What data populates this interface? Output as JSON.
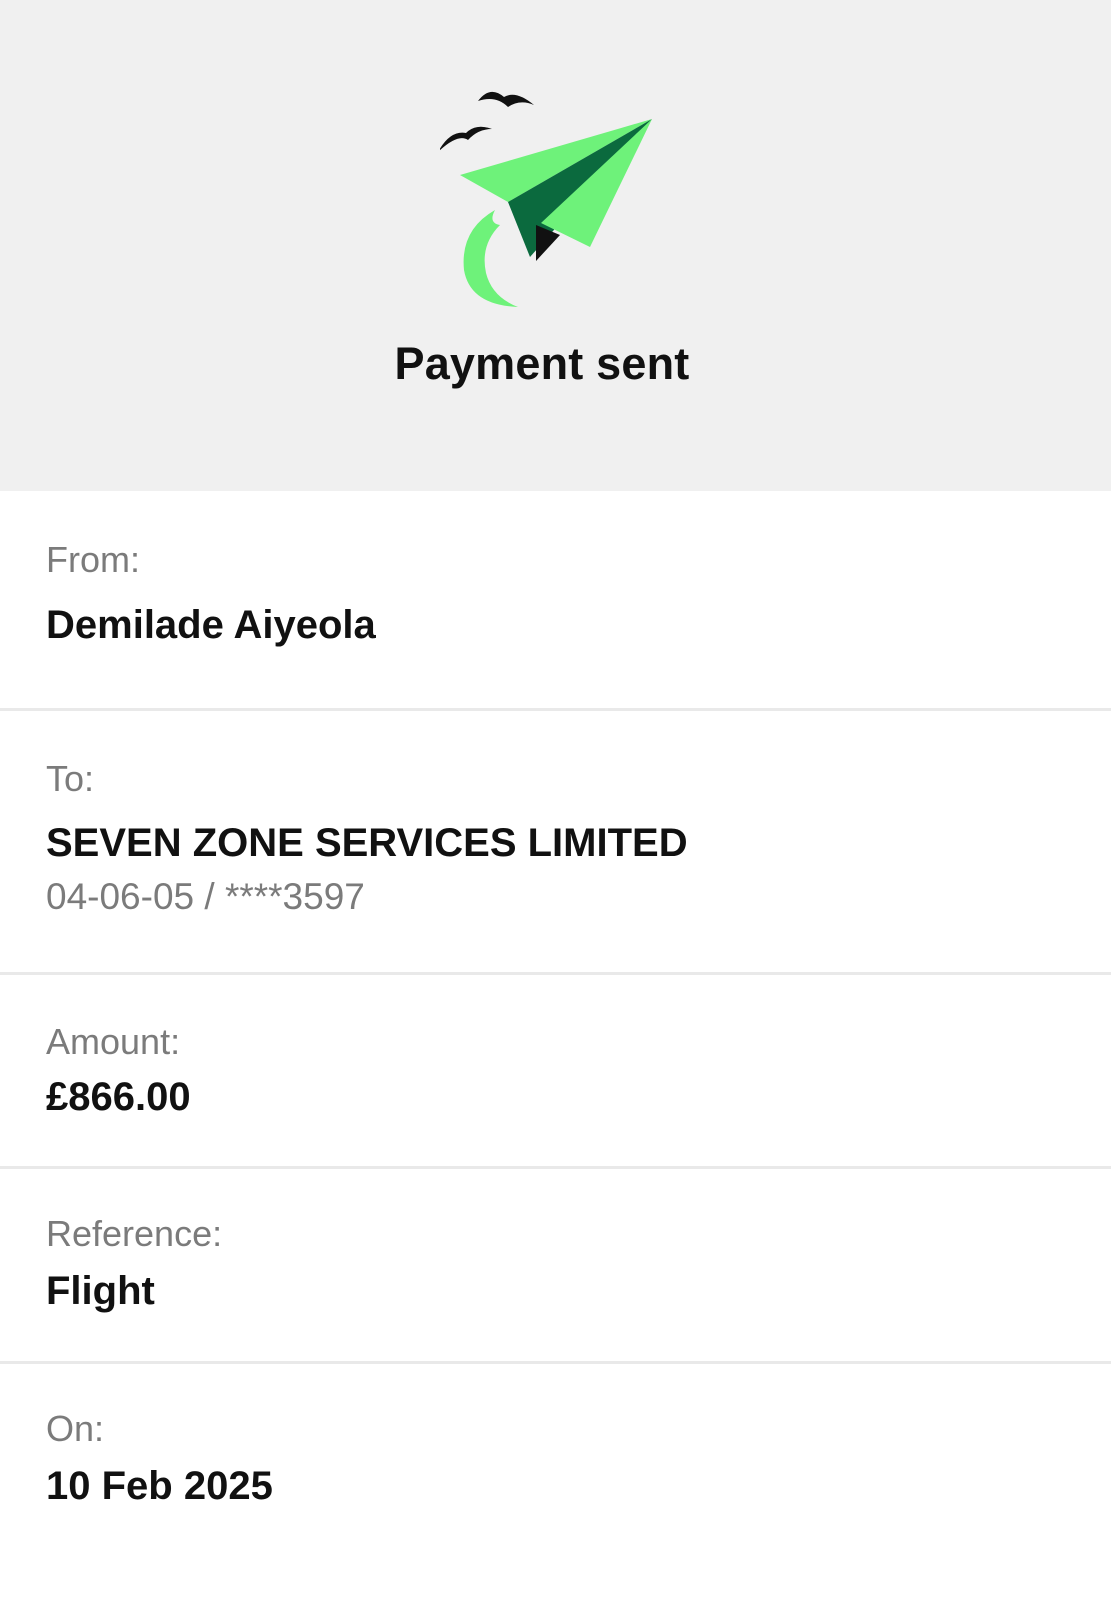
{
  "header": {
    "title": "Payment sent",
    "illustration": "paper-plane-with-birds-icon",
    "colors": {
      "plane_light": "#6ef27a",
      "plane_dark": "#0b6a3e",
      "ink": "#111111",
      "background": "#f0f0f0"
    }
  },
  "details": {
    "from": {
      "label": "From:",
      "value": "Demilade Aiyeola"
    },
    "to": {
      "label": "To:",
      "value": "SEVEN ZONE SERVICES LIMITED",
      "account": "04-06-05 / ****3597"
    },
    "amount": {
      "label": "Amount:",
      "value": "£866.00"
    },
    "reference": {
      "label": "Reference:",
      "value": "Flight"
    },
    "on": {
      "label": "On:",
      "value": "10 Feb 2025"
    }
  }
}
